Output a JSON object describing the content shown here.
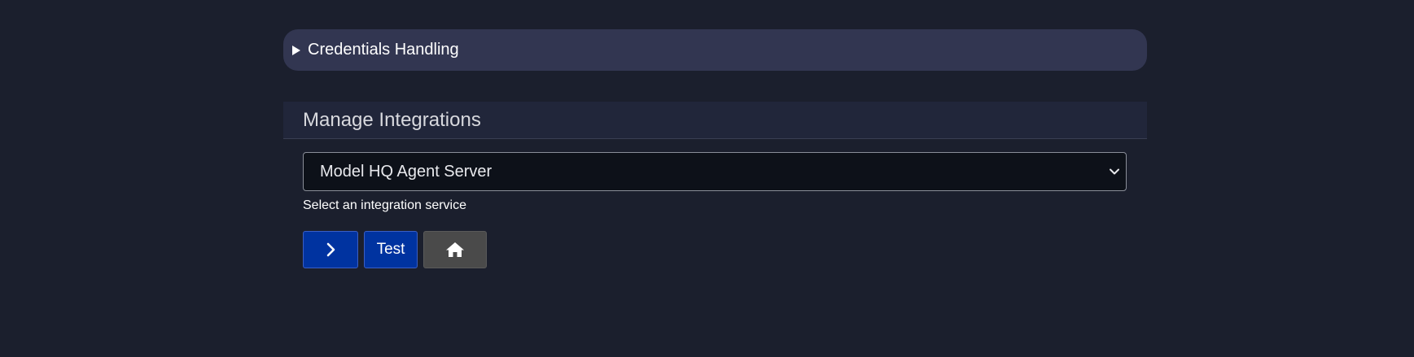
{
  "credentials": {
    "label": "Credentials Handling",
    "icon": "triangle-right-icon"
  },
  "integrations": {
    "title": "Manage Integrations",
    "select": {
      "value": "Model HQ Agent Server",
      "icon": "chevron-down-icon"
    },
    "help_text": "Select an integration service",
    "buttons": {
      "next_icon": "chevron-right-icon",
      "test_label": "Test",
      "home_icon": "home-icon"
    }
  },
  "colors": {
    "background": "#1b1f2d",
    "collapsible_bg": "#323651",
    "header_bg": "#21263a",
    "select_bg": "#0d1119",
    "primary_button": "#0033a0",
    "home_button": "#4a4a4a"
  }
}
